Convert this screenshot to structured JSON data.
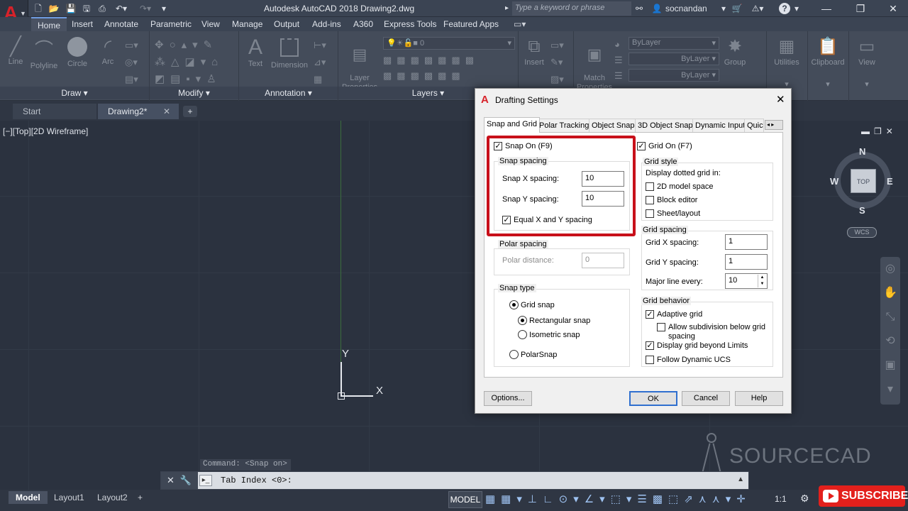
{
  "app": {
    "title": "Autodesk AutoCAD 2018    Drawing2.dwg",
    "search_placeholder": "Type a keyword or phrase",
    "user": "socnandan",
    "help": "?"
  },
  "ribbon_tabs": [
    "Home",
    "Insert",
    "Annotate",
    "Parametric",
    "View",
    "Manage",
    "Output",
    "Add-ins",
    "A360",
    "Express Tools",
    "Featured Apps"
  ],
  "ribbon": {
    "draw_tools": [
      "Line",
      "Polyline",
      "Circle",
      "Arc"
    ],
    "panels": [
      "Draw",
      "Modify",
      "Annotation",
      "Layers"
    ],
    "text_tool": "Text",
    "dimension_tool": "Dimension",
    "layer_properties": "Layer\nProperties",
    "insert_tool": "Insert",
    "match_properties": "Match\nProperties",
    "group_tool": "Group",
    "utilities": "Utilities",
    "clipboard": "Clipboard",
    "view": "View",
    "layer_value": "0",
    "bylayer": [
      "ByLayer",
      "ByLayer",
      "ByLayer"
    ]
  },
  "doc_tabs": [
    "Start",
    "Drawing2*"
  ],
  "viewport": {
    "controls": "[−][Top][2D Wireframe]",
    "axis_x": "X",
    "axis_y": "Y",
    "compass": {
      "n": "N",
      "s": "S",
      "e": "E",
      "w": "W",
      "top": "TOP"
    },
    "wcs": "WCS",
    "watermark": "SOURCECAD"
  },
  "command": {
    "history": "Command:  <Snap on>",
    "prompt": "Tab Index <0>:"
  },
  "layout_tabs": [
    "Model",
    "Layout1",
    "Layout2"
  ],
  "status": {
    "model": "MODEL",
    "scale": "1:1"
  },
  "subscribe": "SUBSCRIBE",
  "dialog": {
    "title": "Drafting Settings",
    "tabs": [
      "Snap and Grid",
      "Polar Tracking",
      "Object Snap",
      "3D Object Snap",
      "Dynamic Input",
      "Quic"
    ],
    "snap_on": {
      "label": "Snap On (F9)",
      "checked": true
    },
    "snap_spacing": {
      "title": "Snap spacing",
      "x_label": "Snap X spacing:",
      "x_value": "10",
      "y_label": "Snap Y spacing:",
      "y_value": "10",
      "equal_label": "Equal X and Y spacing",
      "equal_checked": true
    },
    "polar_spacing": {
      "title": "Polar spacing",
      "distance_label": "Polar distance:",
      "distance_value": "0"
    },
    "snap_type": {
      "title": "Snap type",
      "grid_snap": "Grid snap",
      "rectangular": "Rectangular snap",
      "isometric": "Isometric snap",
      "polar": "PolarSnap"
    },
    "grid_on": {
      "label": "Grid On (F7)",
      "checked": true
    },
    "grid_style": {
      "title": "Grid style",
      "subtitle": "Display dotted grid in:",
      "options": [
        "2D model space",
        "Block editor",
        "Sheet/layout"
      ]
    },
    "grid_spacing": {
      "title": "Grid spacing",
      "x_label": "Grid X spacing:",
      "x_value": "1",
      "y_label": "Grid Y spacing:",
      "y_value": "1",
      "major_label": "Major line every:",
      "major_value": "10"
    },
    "grid_behavior": {
      "title": "Grid behavior",
      "adaptive": "Adaptive grid",
      "subdivision": "Allow subdivision below grid",
      "subdivision2": "spacing",
      "beyond": "Display grid beyond Limits",
      "follow": "Follow Dynamic UCS"
    },
    "buttons": {
      "options": "Options...",
      "ok": "OK",
      "cancel": "Cancel",
      "help": "Help"
    },
    "highlight_color": "#c8101a"
  }
}
